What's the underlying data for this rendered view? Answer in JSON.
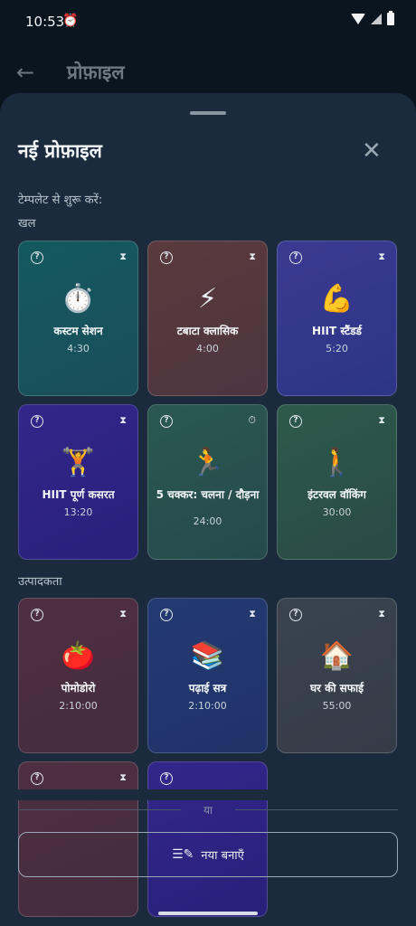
{
  "status": {
    "time": "10:53",
    "alarm_icon": "alarm-icon"
  },
  "appbar": {
    "title": "प्रोफ़ाइल"
  },
  "sheet": {
    "title": "नई प्रोफ़ाइल",
    "subtitle": "टेम्पलेट से शुरू करें:",
    "sections": [
      {
        "label": "खल"
      },
      {
        "label": "उत्पादकता"
      }
    ],
    "cards": [
      {
        "emoji": "⏱️",
        "name": "कस्टम सेशन",
        "duration": "4:30"
      },
      {
        "emoji": "⚡",
        "name": "टबाटा क्लासिक",
        "duration": "4:00"
      },
      {
        "emoji": "💪",
        "name": "HIIT स्टैंडर्ड",
        "duration": "5:20"
      },
      {
        "emoji": "🏋️",
        "name": "HIIT पूर्ण कसरत",
        "duration": "13:20"
      },
      {
        "emoji": "🏃",
        "name": "5 चक्कर: चलना / दौड़ना",
        "duration": "24:00"
      },
      {
        "emoji": "🚶",
        "name": "इंटरवल वॉकिंग",
        "duration": "30:00"
      },
      {
        "emoji": "🍅",
        "name": "पोमोडोरो",
        "duration": "2:10:00"
      },
      {
        "emoji": "📚",
        "name": "पढ़ाई सत्र",
        "duration": "2:10:00"
      },
      {
        "emoji": "🏠",
        "name": "घर की सफाई",
        "duration": "55:00"
      }
    ],
    "or_label": "या",
    "new_button_label": "नया बनाएँ"
  }
}
